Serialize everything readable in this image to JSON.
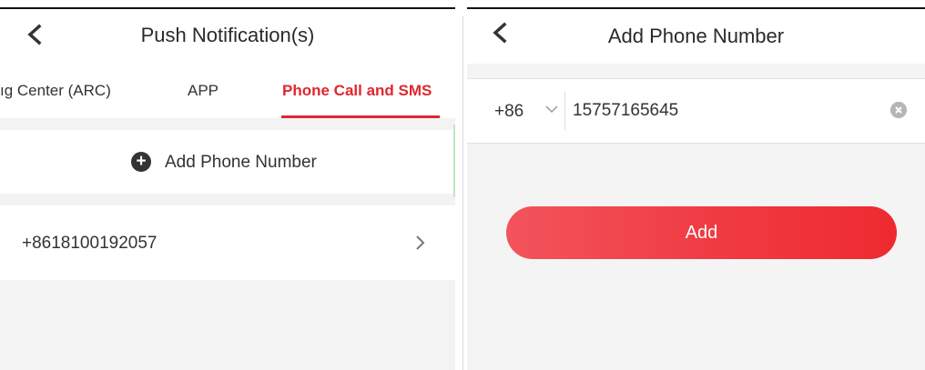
{
  "left_screen": {
    "header": {
      "title": "Push Notification(s)",
      "back_icon": "back-chevron-icon"
    },
    "tabs": [
      {
        "label": "ıg Center (ARC)",
        "active": false
      },
      {
        "label": "APP",
        "active": false
      },
      {
        "label": "Phone Call and SMS",
        "active": true
      }
    ],
    "add_row": {
      "label": "Add Phone Number",
      "icon": "plus-circle-icon"
    },
    "phone_list": [
      {
        "number": "+8618100192057",
        "icon": "chevron-right-icon"
      }
    ]
  },
  "right_screen": {
    "header": {
      "title": "Add Phone Number",
      "back_icon": "back-chevron-icon"
    },
    "country_code": "+86",
    "phone_value": "15757165645",
    "clear_icon": "clear-circle-icon",
    "add_button_label": "Add"
  },
  "colors": {
    "accent": "#e0262f",
    "button_gradient_start": "#f2545c",
    "button_gradient_end": "#ee2a30",
    "page_background": "#f4f4f4"
  }
}
